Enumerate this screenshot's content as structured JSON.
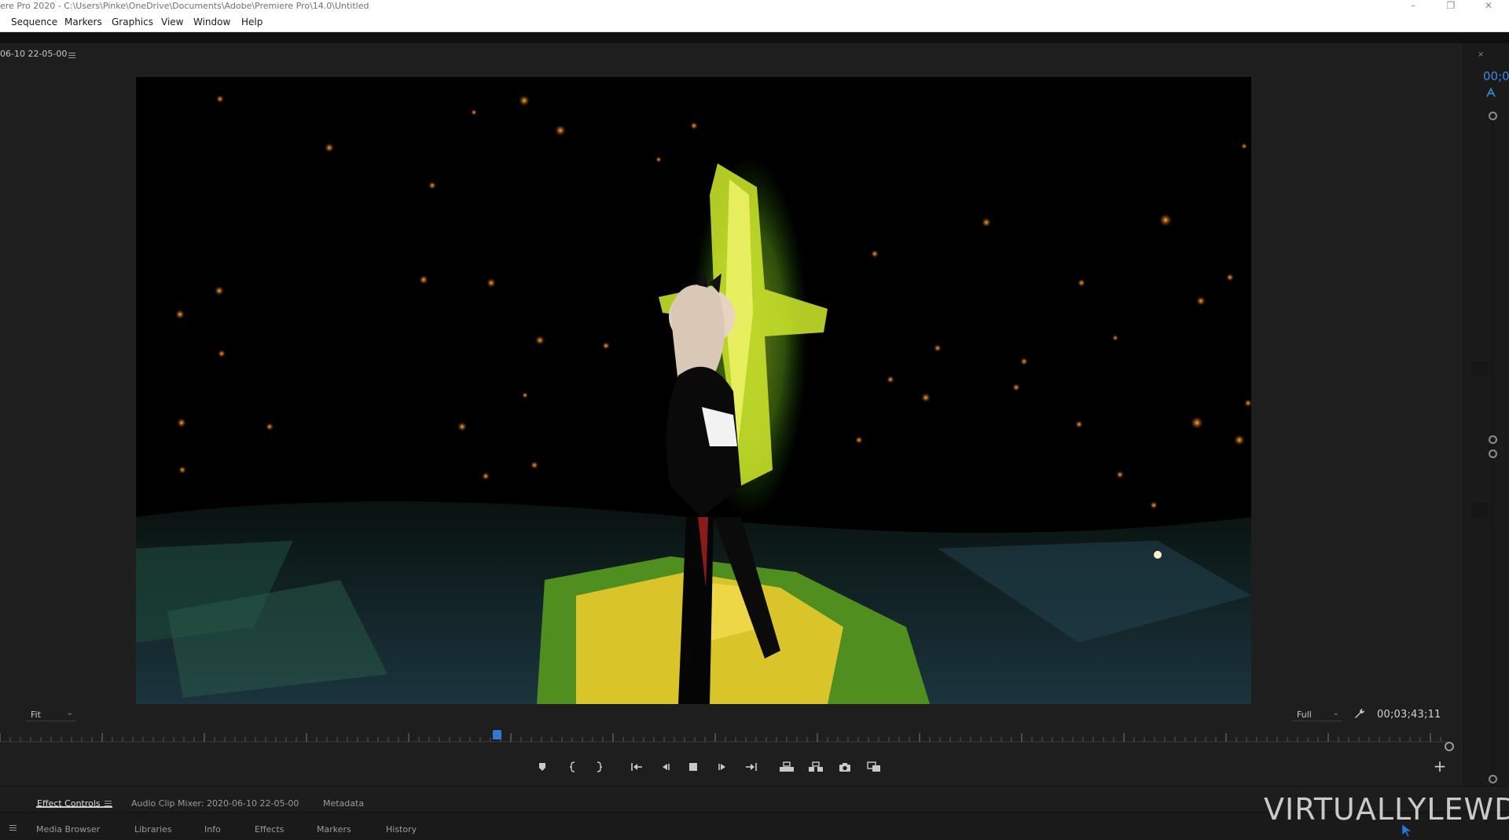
{
  "window": {
    "title": "ere Pro 2020 - C:\\Users\\Pinke\\OneDrive\\Documents\\Adobe\\Premiere Pro\\14.0\\Untitled",
    "controls": [
      "–",
      "❐",
      "✕"
    ]
  },
  "menu": [
    "Sequence",
    "Markers",
    "Graphics",
    "View",
    "Window",
    "Help"
  ],
  "monitor": {
    "sequence_name": "06-10 22-05-00",
    "zoom_value": "Fit",
    "resolution_value": "Full",
    "timecode": "00;03;43;11",
    "playhead_fraction": 0.34,
    "accent_color": "#2f7ad8"
  },
  "transport": [
    {
      "name": "add-marker-button",
      "icon": "marker-icon"
    },
    {
      "name": "mark-in-button",
      "icon": "mark-in-icon"
    },
    {
      "name": "mark-out-button",
      "icon": "mark-out-icon"
    },
    {
      "name": "go-to-in-button",
      "icon": "go-to-in-icon"
    },
    {
      "name": "step-back-button",
      "icon": "step-back-icon"
    },
    {
      "name": "stop-button",
      "icon": "stop-icon"
    },
    {
      "name": "step-forward-button",
      "icon": "step-forward-icon"
    },
    {
      "name": "go-to-out-button",
      "icon": "go-to-out-icon"
    },
    {
      "name": "lift-button",
      "icon": "lift-icon"
    },
    {
      "name": "extract-button",
      "icon": "extract-icon"
    },
    {
      "name": "export-frame-button",
      "icon": "camera-icon"
    },
    {
      "name": "comparison-view-button",
      "icon": "comparison-icon"
    }
  ],
  "timeline_edge": {
    "timecode_partial": "00;0",
    "accent_color": "#3b8de2"
  },
  "panel_tabs_row1": {
    "effect_controls": "Effect Controls",
    "audio_clip_mixer": "Audio Clip Mixer: 2020-06-10 22-05-00",
    "metadata": "Metadata"
  },
  "panel_tabs_row2": {
    "media_browser": "Media Browser",
    "libraries": "Libraries",
    "info": "Info",
    "effects": "Effects",
    "markers": "Markers",
    "history": "History"
  },
  "watermark": "VIRTUALLYLEWD"
}
